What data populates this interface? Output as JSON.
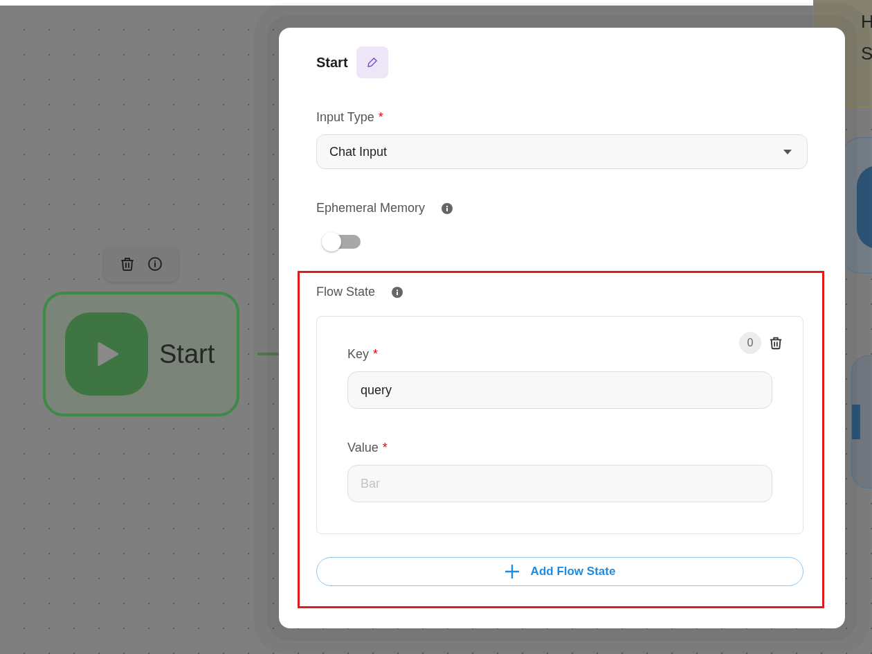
{
  "canvas": {
    "start_node": {
      "label": "Start",
      "toolbar": true
    },
    "side_node": {
      "lines": [
        "H",
        "S"
      ]
    }
  },
  "dialog": {
    "title": "Start",
    "input_type": {
      "label": "Input Type",
      "mark": "*",
      "value": "Chat Input"
    },
    "ephemeral_memory": {
      "label": "Ephemeral Memory",
      "on": false
    },
    "flow_state": {
      "label": "Flow State",
      "highlighted": true,
      "items": [
        {
          "index": "0",
          "key": {
            "label": "Key",
            "mark": "*",
            "value": "query"
          },
          "value": {
            "label": "Value",
            "mark": "*",
            "placeholder": "Bar"
          }
        }
      ],
      "add_button": "Add Flow State"
    }
  }
}
